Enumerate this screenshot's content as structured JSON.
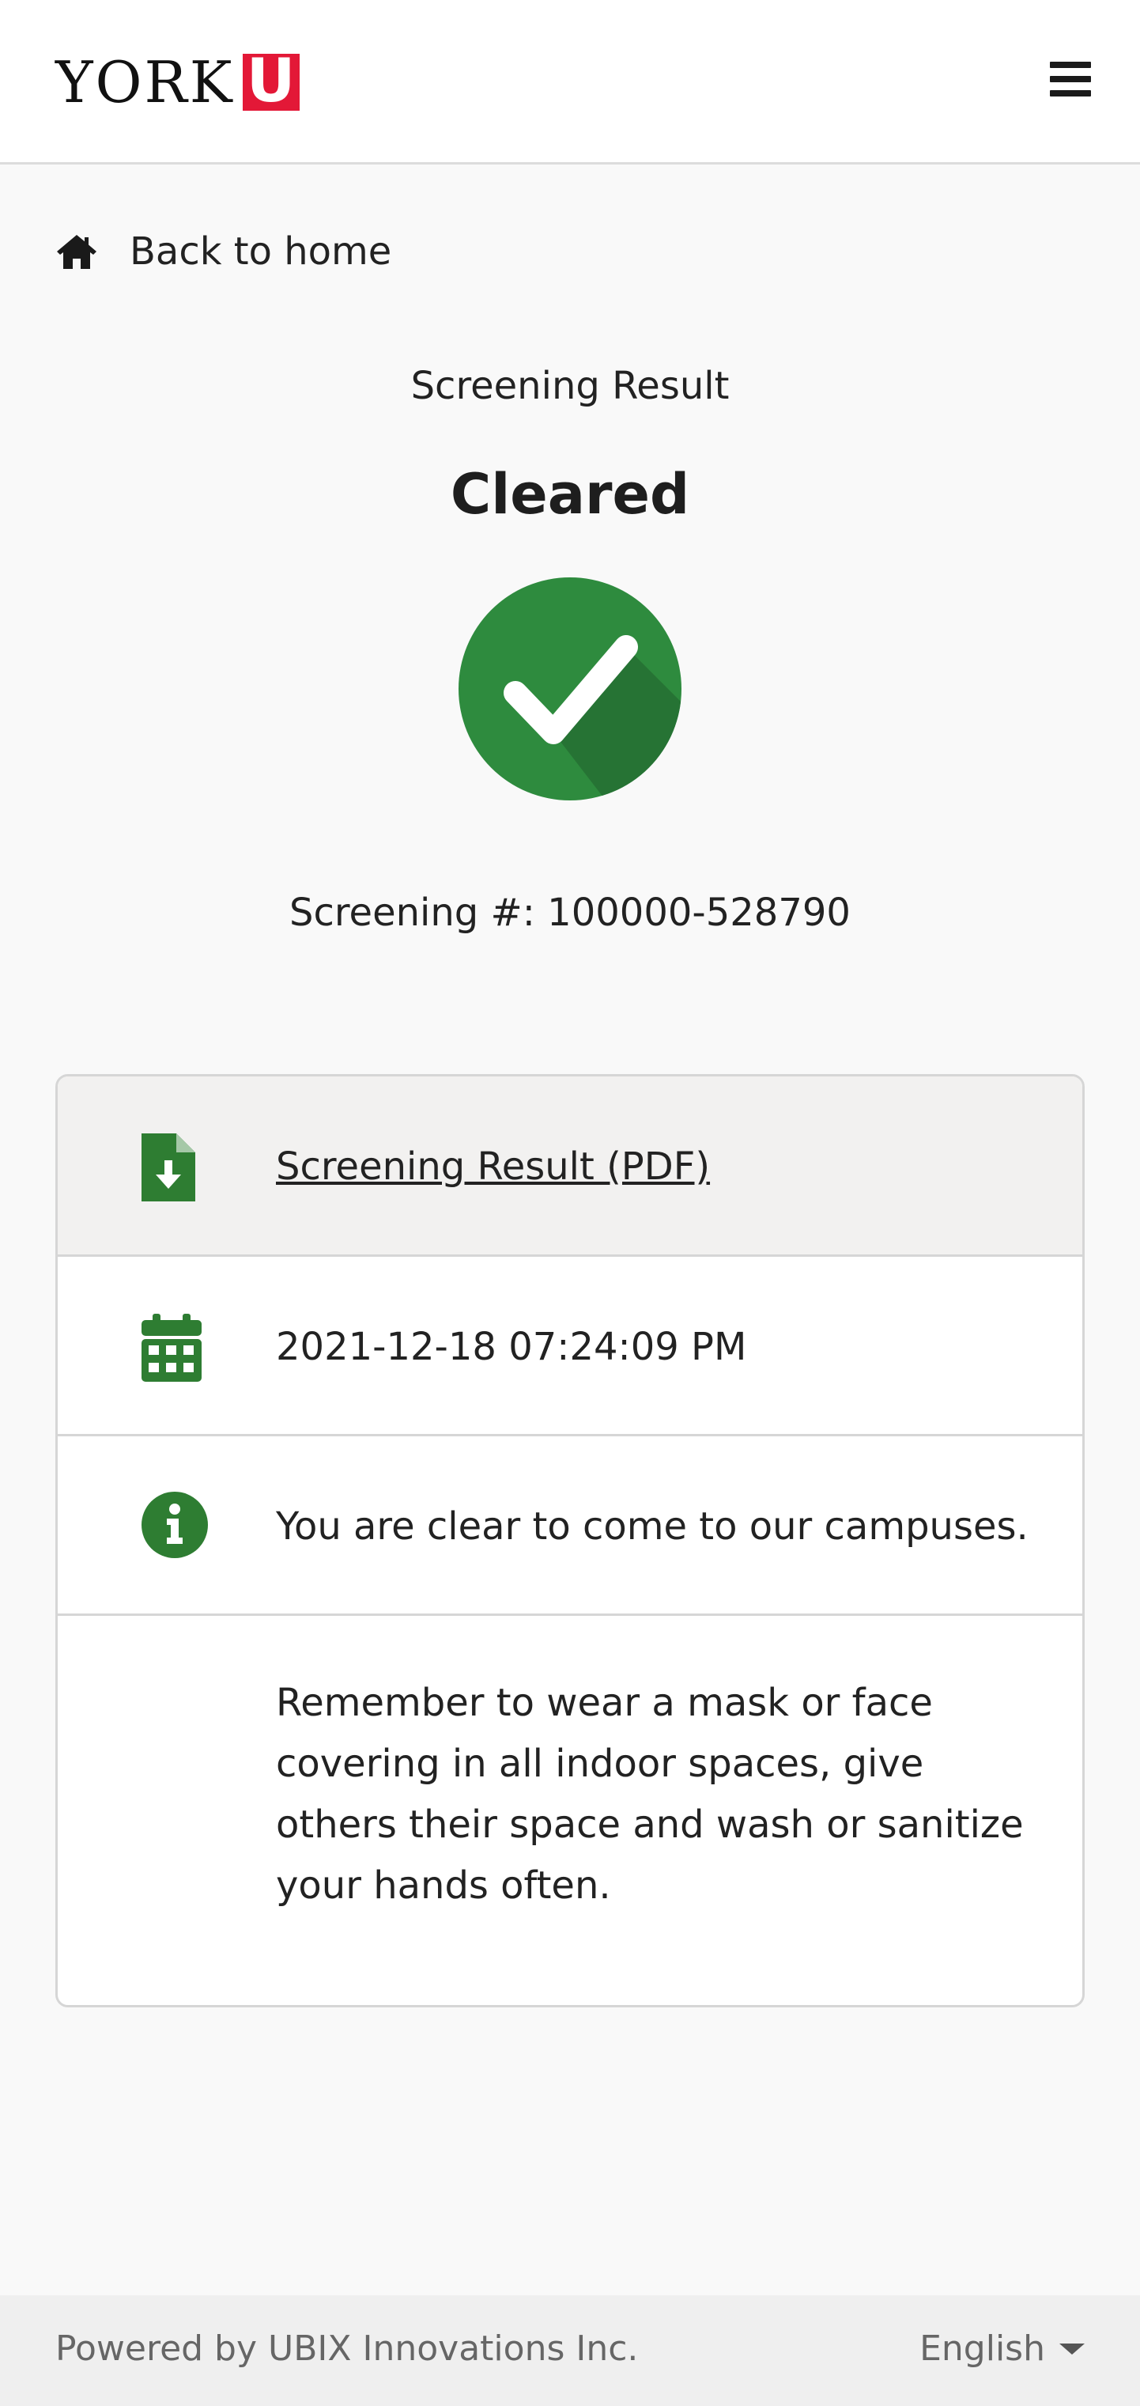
{
  "header": {
    "logo_text": "YORK",
    "logo_mark": "U",
    "brand_color": "#e31837",
    "menu_icon": "hamburger-menu-icon"
  },
  "nav": {
    "back_label": "Back to home",
    "back_icon": "home-icon"
  },
  "result": {
    "title": "Screening Result",
    "status": "Cleared",
    "status_icon": "check-circle-icon",
    "status_color": "#2e8b3e",
    "screening_number": "Screening #: 100000-528790"
  },
  "details": {
    "pdf_link": "Screening Result (PDF)",
    "pdf_icon": "file-download-icon",
    "datetime": "2021-12-18 07:24:09 PM",
    "calendar_icon": "calendar-icon",
    "message": "You are clear to come to our campuses.",
    "info_icon": "info-icon",
    "reminder": "Remember to wear a mask or face covering in all indoor spaces, give others their space and wash or sanitize your hands often.",
    "icon_color": "#2e7d32"
  },
  "footer": {
    "powered_by": "Powered by UBIX Innovations Inc.",
    "language": "English"
  }
}
